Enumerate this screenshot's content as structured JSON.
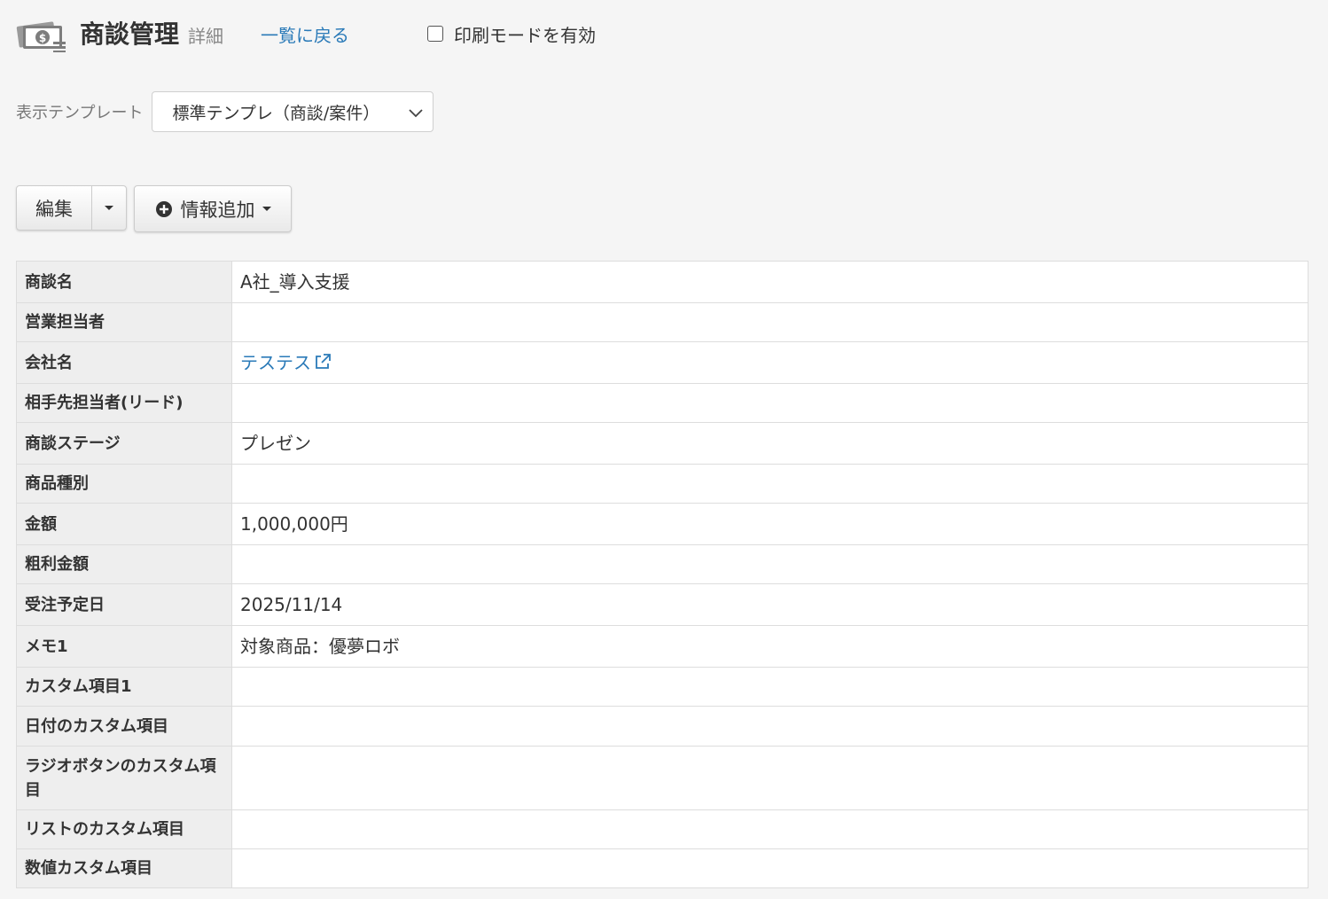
{
  "header": {
    "title": "商談管理",
    "subtitle": "詳細",
    "back_link": "一覧に戻る",
    "print_mode_label": "印刷モードを有効",
    "icon": "money-icon"
  },
  "template": {
    "label": "表示テンプレート",
    "selected": "標準テンプレ（商談/案件）"
  },
  "toolbar": {
    "edit_label": "編集",
    "add_info_label": "情報追加"
  },
  "colors": {
    "link": "#2a7ab8",
    "header_cell_bg": "#eeeeee",
    "border": "#dddddd"
  },
  "fields": [
    {
      "label": "商談名",
      "value": "A社_導入支援"
    },
    {
      "label": "営業担当者",
      "value": ""
    },
    {
      "label": "会社名",
      "value": "テステス"
    },
    {
      "label": "相手先担当者(リード)",
      "value": ""
    },
    {
      "label": "商談ステージ",
      "value": "プレゼン"
    },
    {
      "label": "商品種別",
      "value": ""
    },
    {
      "label": "金額",
      "value": "1,000,000円"
    },
    {
      "label": "粗利金額",
      "value": ""
    },
    {
      "label": "受注予定日",
      "value": "2025/11/14"
    },
    {
      "label": "メモ1",
      "value": "対象商品：優夢ロボ"
    },
    {
      "label": "カスタム項目1",
      "value": ""
    },
    {
      "label": "日付のカスタム項目",
      "value": ""
    },
    {
      "label": "ラジオボタンのカスタム項目",
      "value": ""
    },
    {
      "label": "リストのカスタム項目",
      "value": ""
    },
    {
      "label": "数値カスタム項目",
      "value": ""
    }
  ]
}
